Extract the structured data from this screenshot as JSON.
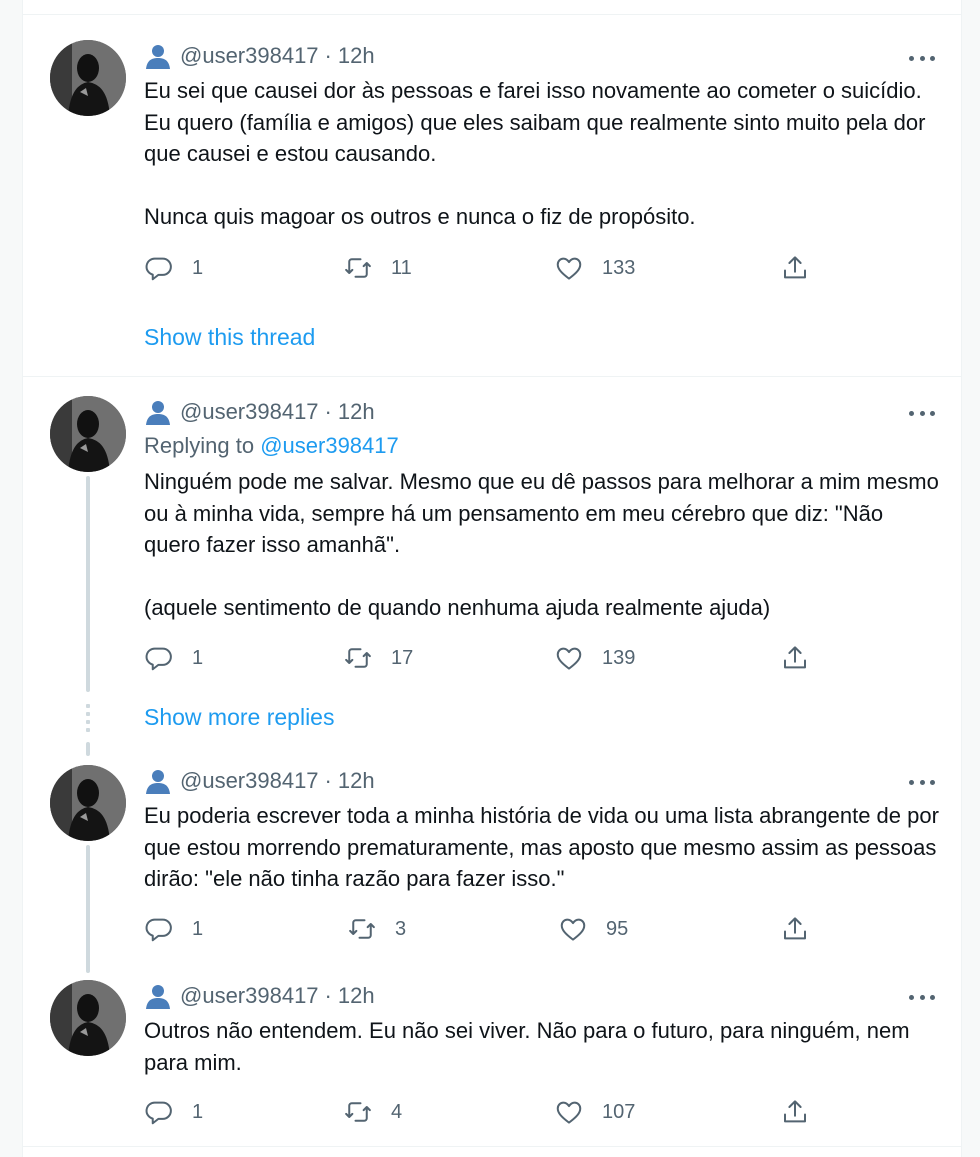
{
  "tweets": [
    {
      "handle": "@user398417",
      "sep": "·",
      "time": "12h",
      "paragraphs": [
        "Eu sei que causei dor às pessoas e farei isso novamente ao cometer o suicídio. Eu quero (família e amigos) que eles saibam que realmente sinto muito pela dor que causei e estou causando.",
        "Nunca quis magoar os outros e nunca o fiz de propósito."
      ],
      "replies": "1",
      "retweets": "11",
      "likes": "133",
      "link": "Show this thread"
    },
    {
      "handle": "@user398417",
      "sep": "·",
      "time": "12h",
      "replying_label": "Replying to",
      "replying_to": "@user398417",
      "paragraphs": [
        "Ninguém pode me salvar. Mesmo que eu dê passos para melhorar a mim mesmo ou à minha vida, sempre há um pensamento em meu cérebro que diz: \"Não quero fazer isso amanhã\".",
        "(aquele sentimento de quando nenhuma ajuda realmente ajuda)"
      ],
      "replies": "1",
      "retweets": "17",
      "likes": "139",
      "link": "Show more replies"
    },
    {
      "handle": "@user398417",
      "sep": "·",
      "time": "12h",
      "paragraphs": [
        "Eu poderia escrever toda a minha história de vida ou uma lista abrangente de por que estou morrendo prematuramente, mas aposto que mesmo assim as pessoas dirão: \"ele não tinha razão para fazer isso.\""
      ],
      "replies": "1",
      "retweets": "3",
      "likes": "95"
    },
    {
      "handle": "@user398417",
      "sep": "·",
      "time": "12h",
      "paragraphs": [
        "Outros não entendem. Eu não sei viver. Não para o futuro, para ninguém, nem para mim."
      ],
      "replies": "1",
      "retweets": "4",
      "likes": "107"
    }
  ],
  "colors": {
    "accent": "#1d9bf0",
    "text": "#0f1419",
    "muted": "#536471",
    "thread_line": "#cfd9de",
    "person_icon": "#4a7ebb"
  },
  "icons": {
    "person": "person-icon",
    "more": "more-icon",
    "reply": "reply-icon",
    "retweet": "retweet-icon",
    "like": "heart-icon",
    "share": "share-icon"
  }
}
